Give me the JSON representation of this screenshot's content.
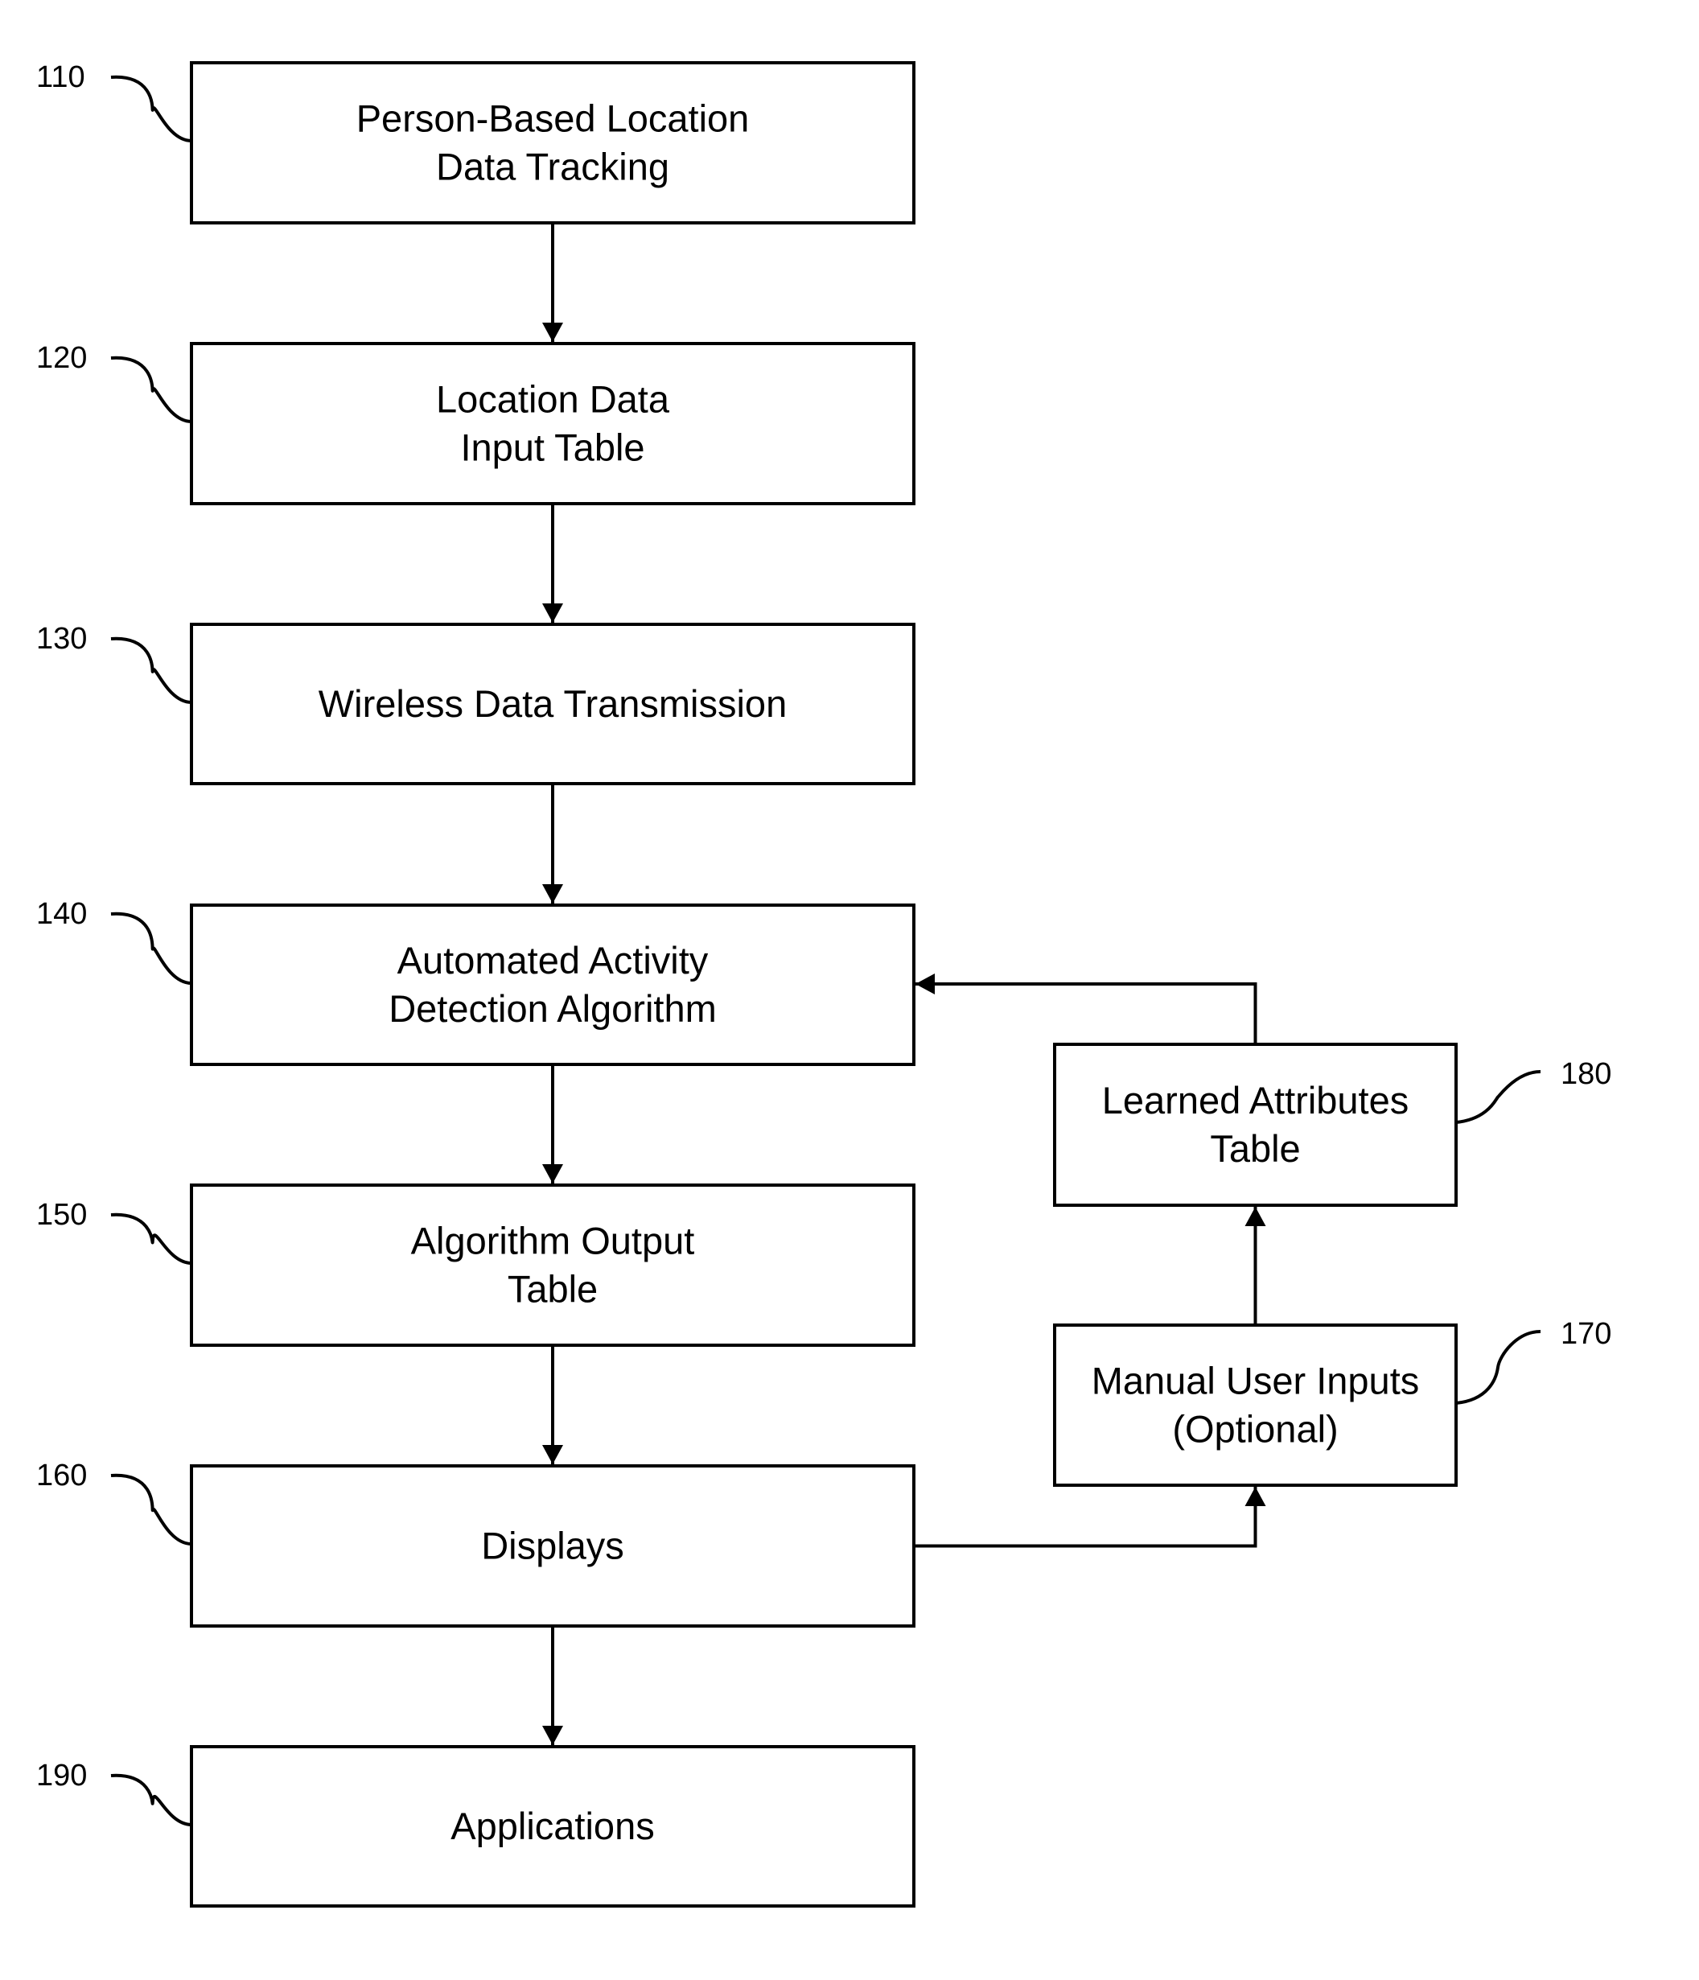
{
  "diagram": {
    "type": "flowchart",
    "colors": {
      "stroke": "#000000",
      "background": "#ffffff"
    },
    "nodes": [
      {
        "id": "110",
        "ref": "110",
        "lines": [
          "Person-Based Location",
          "Data Tracking"
        ]
      },
      {
        "id": "120",
        "ref": "120",
        "lines": [
          "Location Data",
          "Input Table"
        ]
      },
      {
        "id": "130",
        "ref": "130",
        "lines": [
          "Wireless Data Transmission"
        ]
      },
      {
        "id": "140",
        "ref": "140",
        "lines": [
          "Automated Activity",
          "Detection Algorithm"
        ]
      },
      {
        "id": "150",
        "ref": "150",
        "lines": [
          "Algorithm Output",
          "Table"
        ]
      },
      {
        "id": "160",
        "ref": "160",
        "lines": [
          "Displays"
        ]
      },
      {
        "id": "170",
        "ref": "170",
        "lines": [
          "Manual User Inputs",
          "(Optional)"
        ]
      },
      {
        "id": "180",
        "ref": "180",
        "lines": [
          "Learned Attributes",
          "Table"
        ]
      },
      {
        "id": "190",
        "ref": "190",
        "lines": [
          "Applications"
        ]
      }
    ],
    "edges": [
      {
        "from": "110",
        "to": "120"
      },
      {
        "from": "120",
        "to": "130"
      },
      {
        "from": "130",
        "to": "140"
      },
      {
        "from": "140",
        "to": "150"
      },
      {
        "from": "150",
        "to": "160"
      },
      {
        "from": "160",
        "to": "190"
      },
      {
        "from": "160",
        "to": "170"
      },
      {
        "from": "170",
        "to": "180"
      },
      {
        "from": "180",
        "to": "140"
      }
    ]
  }
}
